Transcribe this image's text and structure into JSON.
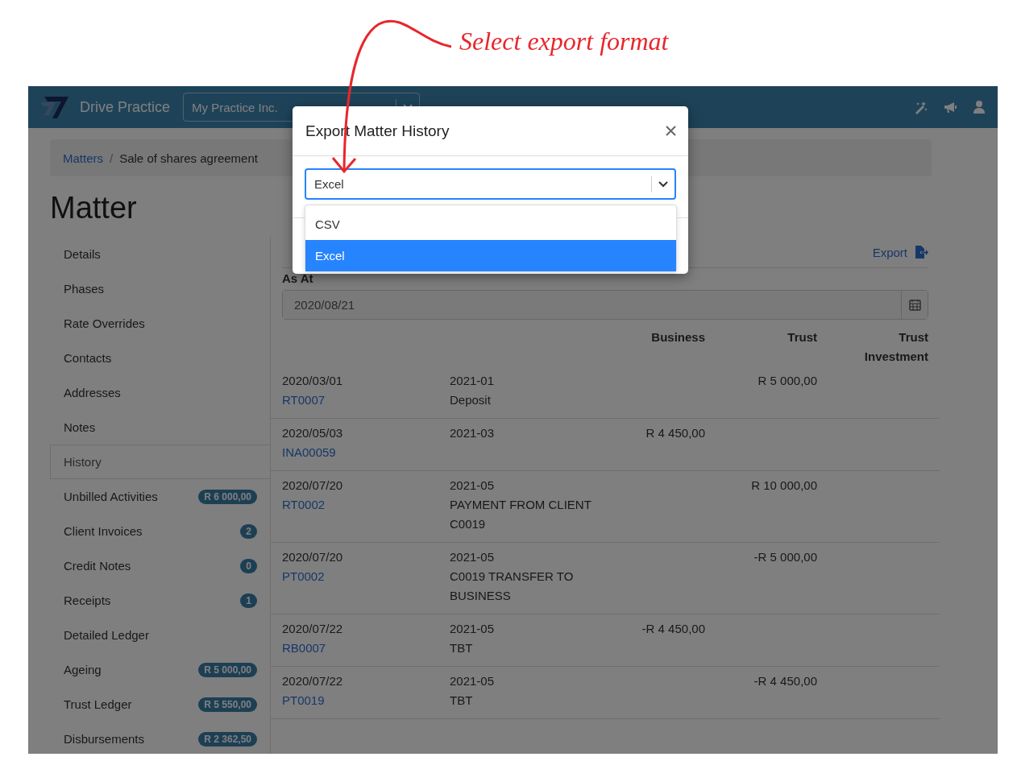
{
  "annotation": {
    "text": "Select export format"
  },
  "navbar": {
    "brand": "Drive Practice",
    "practice_select": "My Practice Inc."
  },
  "breadcrumb": {
    "items": [
      "Matters",
      "Sale of shares agreement"
    ],
    "separator": "/"
  },
  "page_title": "Matter",
  "sidebar": {
    "items": [
      {
        "label": "Details",
        "selected": false
      },
      {
        "label": "Phases",
        "selected": false
      },
      {
        "label": "Rate Overrides",
        "selected": false
      },
      {
        "label": "Contacts",
        "selected": false
      },
      {
        "label": "Addresses",
        "selected": false
      },
      {
        "label": "Notes",
        "selected": false
      },
      {
        "label": "History",
        "selected": true
      },
      {
        "label": "Unbilled Activities",
        "badge": "R 6 000,00",
        "selected": false
      },
      {
        "label": "Client Invoices",
        "badge": "2",
        "selected": false
      },
      {
        "label": "Credit Notes",
        "badge": "0",
        "selected": false
      },
      {
        "label": "Receipts",
        "badge": "1",
        "selected": false
      },
      {
        "label": "Detailed Ledger",
        "selected": false
      },
      {
        "label": "Ageing",
        "badge": "R 5 000,00",
        "selected": false
      },
      {
        "label": "Trust Ledger",
        "badge": "R 5 550,00",
        "selected": false
      },
      {
        "label": "Disbursements",
        "badge": "R 2 362,50",
        "selected": false
      }
    ]
  },
  "history": {
    "export": "Export",
    "as_at_label": "As At",
    "as_at_value": "2020/08/21",
    "columns": [
      "Business",
      "Trust",
      "Trust Investment"
    ],
    "rows": [
      {
        "date": "2020/03/01",
        "ref": "RT0007",
        "period": "2021-01",
        "description": "Deposit",
        "trust": "R 5 000,00"
      },
      {
        "date": "2020/05/03",
        "ref": "INA00059",
        "period": "2021-03",
        "business": "R 4 450,00"
      },
      {
        "date": "2020/07/20",
        "ref": "RT0002",
        "period": "2021-05",
        "description": "PAYMENT FROM CLIENT C0019",
        "trust": "R 10 000,00"
      },
      {
        "date": "2020/07/20",
        "ref": "PT0002",
        "period": "2021-05",
        "description": "C0019 TRANSFER TO BUSINESS",
        "trust": "-R 5 000,00"
      },
      {
        "date": "2020/07/22",
        "ref": "RB0007",
        "period": "2021-05",
        "description": "TBT",
        "business": "-R 4 450,00"
      },
      {
        "date": "2020/07/22",
        "ref": "PT0019",
        "period": "2021-05",
        "description": "TBT",
        "trust": "-R 4 450,00"
      }
    ]
  },
  "modal": {
    "title": "Export Matter History",
    "select_value": "Excel",
    "options": [
      {
        "label": "CSV",
        "selected": false
      },
      {
        "label": "Excel",
        "selected": true
      }
    ]
  }
}
